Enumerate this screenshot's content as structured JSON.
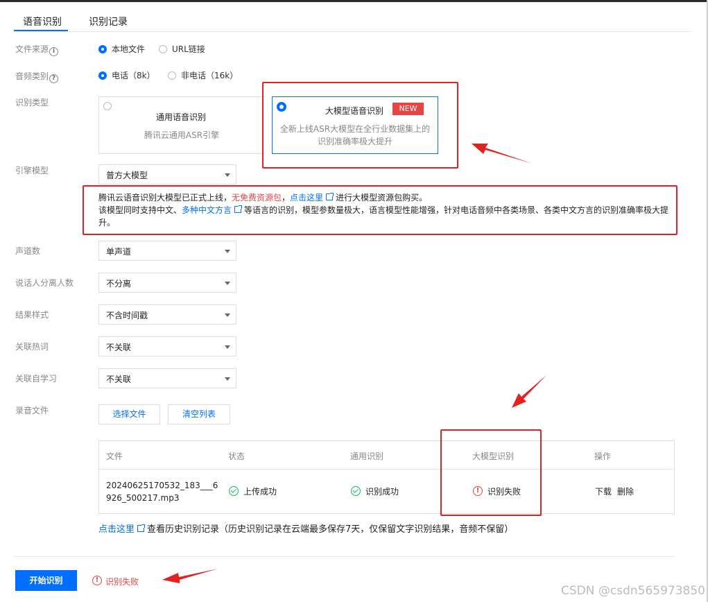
{
  "tabs": [
    {
      "label": "语音识别",
      "active": true
    },
    {
      "label": "识别记录",
      "active": false
    }
  ],
  "form": {
    "file_source": {
      "label": "文件来源",
      "help_icon": "info-icon",
      "options": [
        "本地文件",
        "URL链接"
      ],
      "selected": "本地文件"
    },
    "audio_type": {
      "label": "音频类别",
      "help_icon": "help-icon",
      "options": [
        "电话（8k）",
        "非电话（16k）"
      ],
      "selected": "电话（8k）"
    },
    "recognition_type": {
      "label": "识别类型",
      "cards": [
        {
          "title": "通用语音识别",
          "desc": "腾讯云通用ASR引擎",
          "selected": false
        },
        {
          "title": "大模型语音识别",
          "badge": "NEW",
          "desc_line1": "全新上线ASR大模型在全行业数据集上的",
          "desc_line2": "识别准确率极大提升",
          "selected": true
        }
      ]
    },
    "engine_model": {
      "label": "引擎模型",
      "value": "普方大模型"
    },
    "notice": {
      "line1_a": "腾讯云语音识别大模型已正式上线，",
      "line1_red": "无免费资源包",
      "line1_sep": "，",
      "line1_link": "点击这里",
      "line1_b": "进行大模型资源包购买。",
      "line2_a": "该模型同时支持中文、",
      "line2_link": "多种中文方言",
      "line2_b": "等语言的识别，模型参数量极大，语言模型性能增强，针对电话音频中各类场景、各类中文方言的识别准确率极大提",
      "line3": "升。"
    },
    "channels": {
      "label": "声道数",
      "value": "单声道"
    },
    "speaker_separation": {
      "label": "说话人分离人数",
      "value": "不分离"
    },
    "result_style": {
      "label": "结果样式",
      "value": "不含时间戳"
    },
    "hotword": {
      "label": "关联热词",
      "value": "不关联"
    },
    "self_learning": {
      "label": "关联自学习",
      "value": "不关联"
    },
    "audio_file": {
      "label": "录音文件",
      "choose_button": "选择文件",
      "clear_button": "清空列表"
    }
  },
  "table": {
    "headers": [
      "文件",
      "状态",
      "通用识别",
      "大模型识别",
      "操作"
    ],
    "rows": [
      {
        "file_line1": "20240625170532_183___6",
        "file_line2": "926_500217.mp3",
        "status": "上传成功",
        "general": "识别成功",
        "large_model": "识别失败",
        "actions": [
          "下载",
          "删除"
        ]
      }
    ]
  },
  "history": {
    "link": "点击这里",
    "text": "查看历史识别记录（历史识别记录在云端最多保存7天，仅保留文字识别结果，音频不保留）"
  },
  "footer": {
    "start_button": "开始识别",
    "status_text": "识别失败"
  },
  "watermark": "CSDN @csdn565973850",
  "colors": {
    "primary": "#006eff",
    "error": "#e54545",
    "success": "#0abf5b",
    "annotation": "#e52020"
  }
}
